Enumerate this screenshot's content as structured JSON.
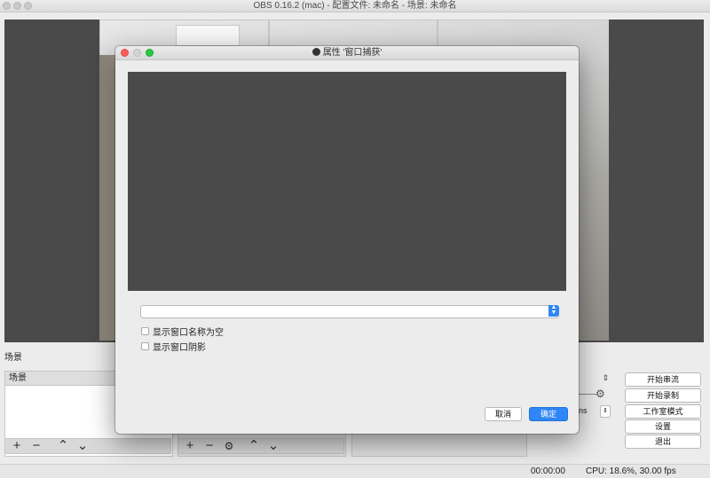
{
  "window": {
    "title": "OBS 0.16.2 (mac) - 配置文件: 未命名 - 场景: 未命名"
  },
  "scenes": {
    "dock_title": "场景",
    "header": "场景"
  },
  "toolbar": {
    "add_icon": "plus-icon",
    "remove_icon": "minus-icon",
    "up_icon": "chevron-up-icon",
    "down_icon": "chevron-down-icon",
    "settings_icon": "gear-icon"
  },
  "controls": {
    "start_stream": "开始串流",
    "start_record": "开始录制",
    "studio_mode": "工作室模式",
    "settings": "设置",
    "exit": "退出",
    "partial_label": "ns"
  },
  "status": {
    "time": "00:00:00",
    "cpu": "CPU: 18.6%, 30.00 fps"
  },
  "dialog": {
    "title": "属性 '窗口捕获'",
    "window_select_value": "",
    "show_empty_names": "显示窗口名称为空",
    "show_shadow": "显示窗口阴影",
    "cancel": "取消",
    "ok": "确定"
  },
  "colors": {
    "accent": "#2f86f6",
    "close": "#fc5f57",
    "minimize": "#fdbc2e",
    "zoom": "#28c840",
    "preview_bg": "#4a4a4a"
  }
}
